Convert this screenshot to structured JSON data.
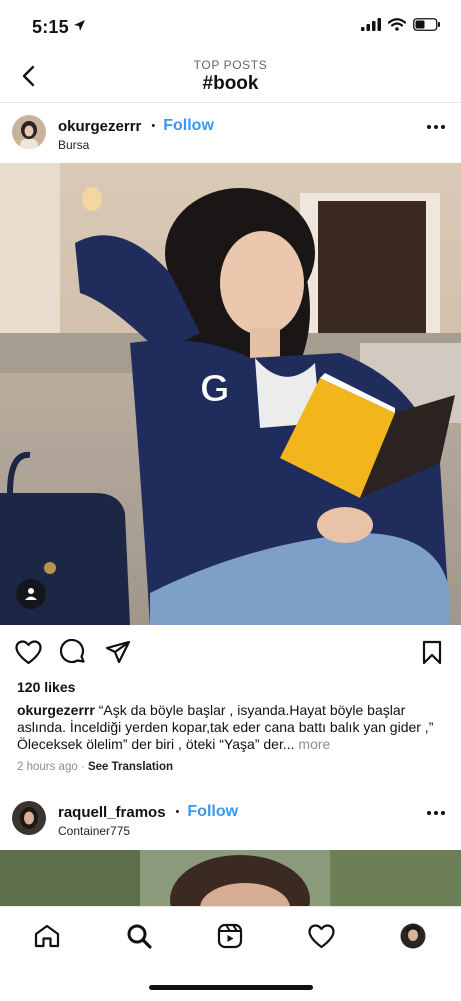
{
  "status": {
    "time": "5:15"
  },
  "header": {
    "subtitle": "TOP POSTS",
    "title": "#book"
  },
  "posts": [
    {
      "username": "okurgezerrr",
      "follow_label": "Follow",
      "location": "Bursa",
      "likes": "120 likes",
      "caption_user": "okurgezerrr",
      "caption_text": " “Aşk da böyle başlar , isyanda.Hayat böyle başlar aslında. İnceldiği yerden kopar,tak eder cana battı balık yan gider ,” Öleceksek ölelim” der biri , öteki “Yaşa” der...",
      "more_label": " more",
      "time_ago": "2 hours ago",
      "see_translation": "See Translation"
    },
    {
      "username": "raquell_framos",
      "follow_label": "Follow",
      "location": "Container775"
    }
  ],
  "icons": {
    "location_arrow": "location-arrow-icon",
    "signal": "cellular-signal-icon",
    "wifi": "wifi-icon",
    "battery": "battery-icon",
    "back": "chevron-left-icon",
    "more": "more-horizontal-icon",
    "like": "heart-icon",
    "comment": "comment-icon",
    "share": "paper-plane-icon",
    "save": "bookmark-icon",
    "user_tag": "person-icon",
    "home": "home-icon",
    "search": "search-icon",
    "reels": "reels-icon",
    "activity": "heart-icon",
    "profile": "profile-avatar"
  },
  "colors": {
    "link": "#3897f0",
    "muted": "#8e8e8e",
    "book": "#f2b51c",
    "hoodie": "#1f2c5c"
  }
}
